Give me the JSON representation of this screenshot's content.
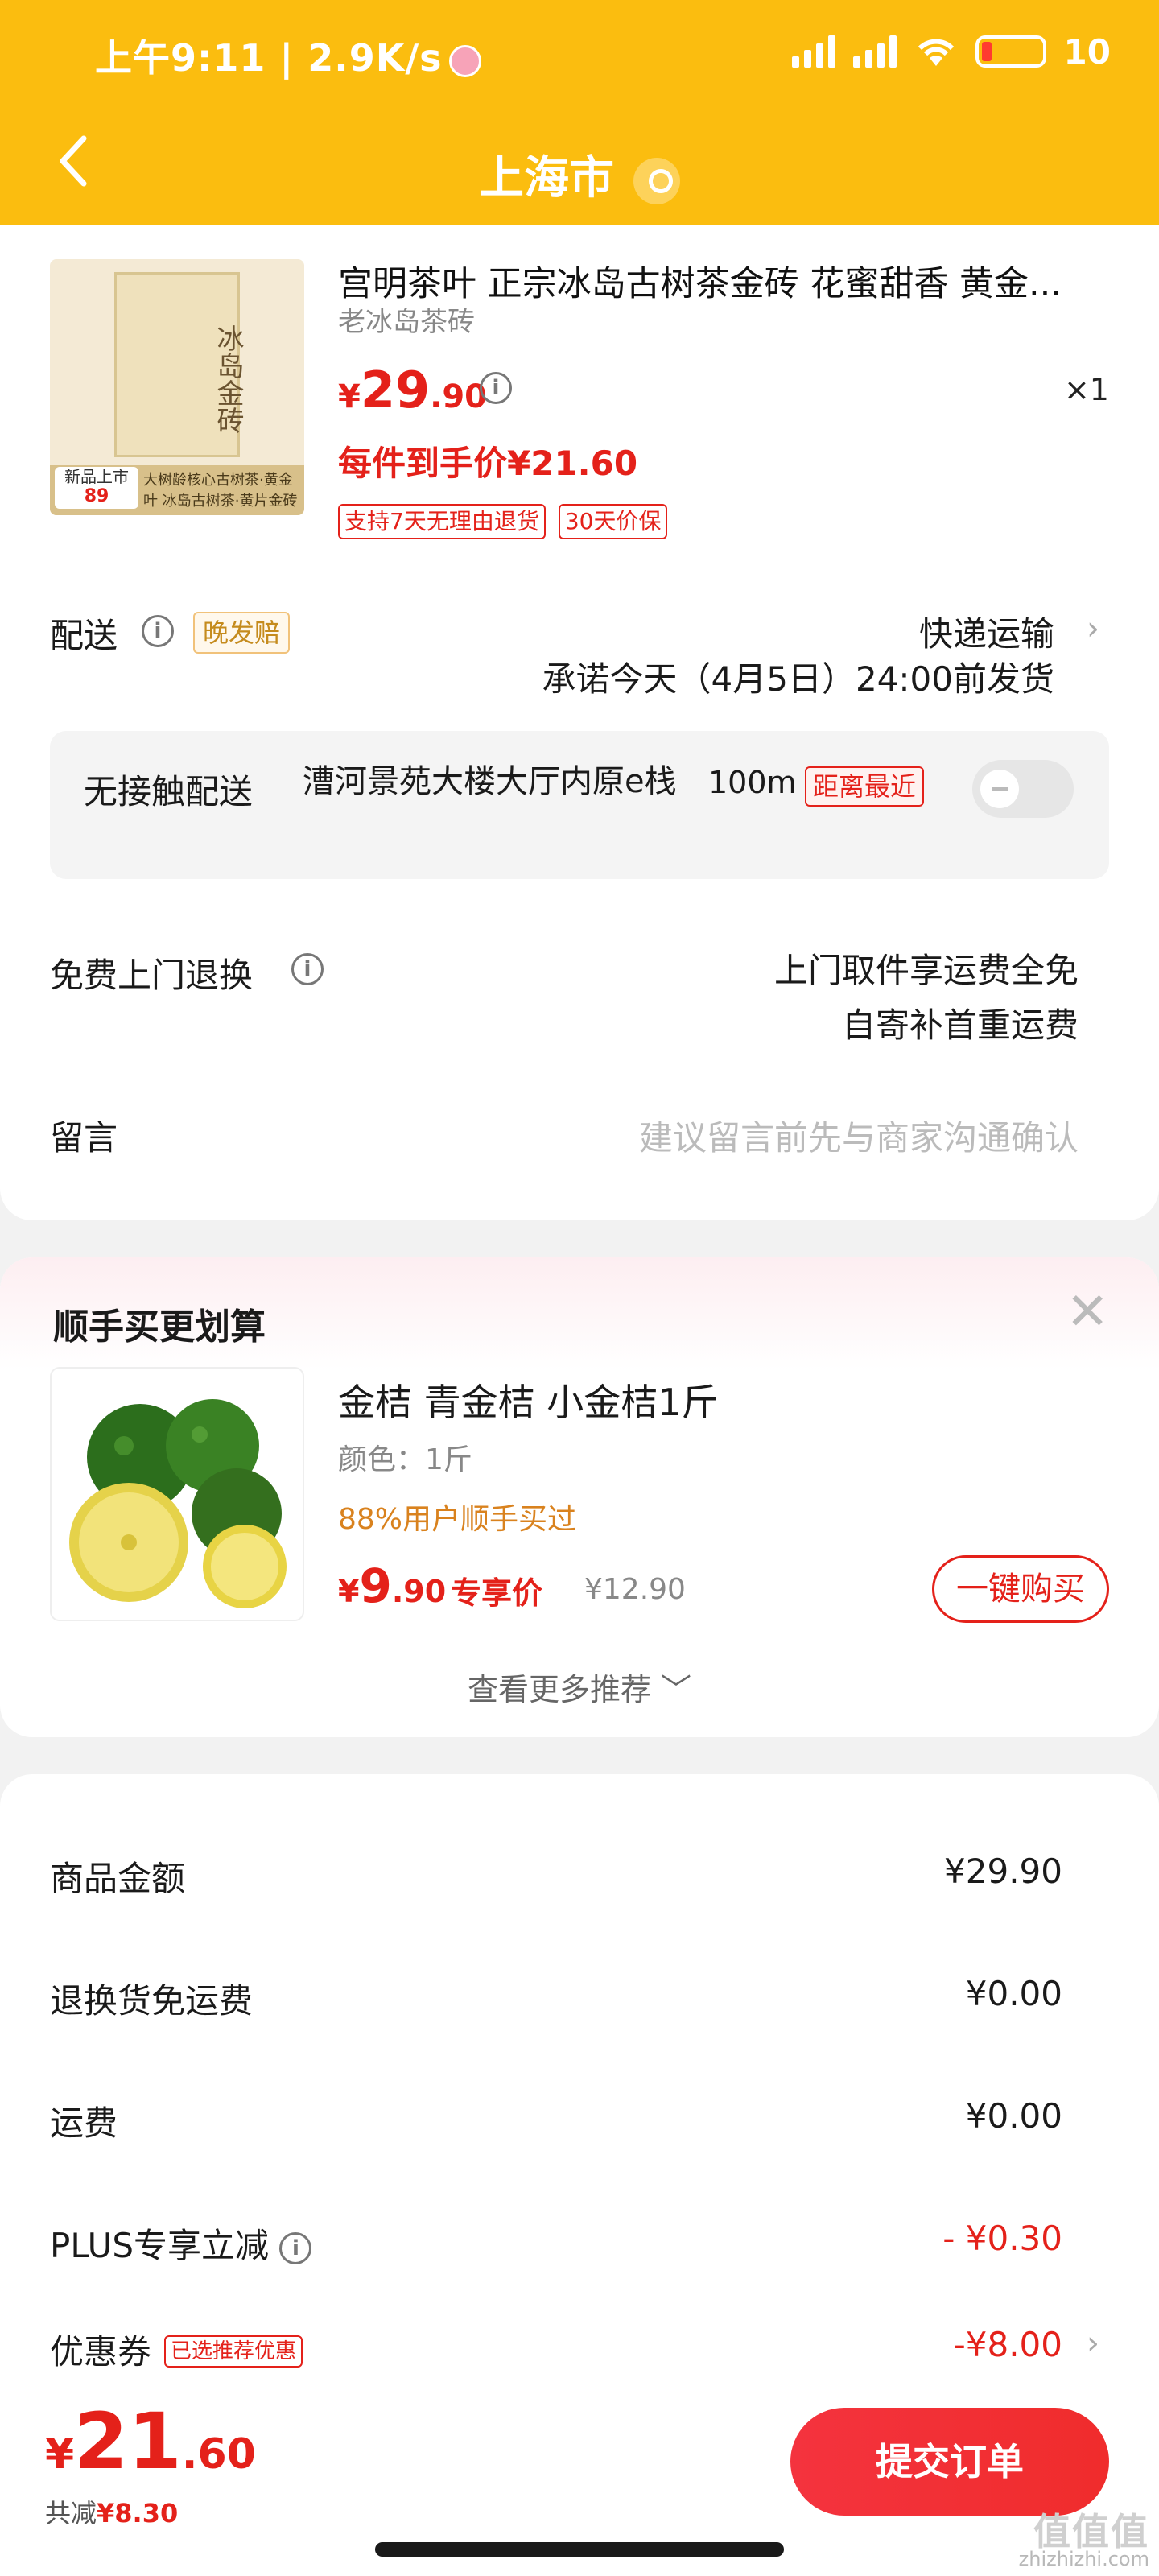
{
  "status": {
    "time": "上午9:11 | 2.9K/s",
    "battery": "10"
  },
  "nav": {
    "title": "上海市"
  },
  "product": {
    "title": "宫明茶叶 正宗冰岛古树茶金砖 花蜜甜香 黄金...",
    "subtitle": "老冰岛茶砖",
    "brick_text": "冰岛金砖",
    "badge_new": "新品上市",
    "badge_num": "89",
    "img_desc": "大树龄核心古树茶·黄金叶 冰岛古树茶·黄片金砖",
    "price_symbol": "¥",
    "price_int": "29",
    "price_dec": ".90",
    "qty": "×1",
    "final_price": "每件到手价¥21.60",
    "tags": [
      "支持7天无理由退货",
      "30天价保"
    ]
  },
  "delivery": {
    "label": "配送",
    "late_tag": "晚发赔",
    "method": "快递运输",
    "promise": "承诺今天（4月5日）24:00前发货"
  },
  "contactless": {
    "label": "无接触配送",
    "address": "漕河景苑大楼大厅内原e栈",
    "distance": "100m",
    "near_tag": "距离最近"
  },
  "returns": {
    "label": "免费上门退换",
    "line1": "上门取件享运费全免",
    "line2": "自寄补首重运费"
  },
  "message": {
    "label": "留言",
    "placeholder": "建议留言前先与商家沟通确认"
  },
  "addon": {
    "title": "顺手买更划算",
    "close": "✕",
    "name": "金桔 青金桔 小金桔1斤",
    "spec": "颜色：1斤",
    "pct": "88%用户顺手买过",
    "price_symbol": "¥",
    "price_int": "9",
    "price_dec": ".90",
    "exclusive": "专享价",
    "original": "¥12.90",
    "buy_btn": "一键购买",
    "more": "查看更多推荐 ﹀"
  },
  "summary": [
    {
      "label": "商品金额",
      "value": "¥29.90"
    },
    {
      "label": "退换货免运费",
      "value": "¥0.00"
    },
    {
      "label": "运费",
      "value": "¥0.00"
    },
    {
      "label": "PLUS专享立减",
      "value": "- ¥0.30"
    },
    {
      "label": "优惠券",
      "value": "-¥8.00",
      "tag": "已选推荐优惠"
    }
  ],
  "footer": {
    "total_symbol": "¥",
    "total_int": "21",
    "total_dec": ".60",
    "save_label": "共减",
    "save_value": "¥8.30",
    "submit": "提交订单"
  },
  "watermark": {
    "title": "值值值",
    "url": "zhizhizhi.com"
  },
  "colors": {
    "brand_yellow": "#fbbd0f",
    "accent_red": "#e4211a"
  }
}
